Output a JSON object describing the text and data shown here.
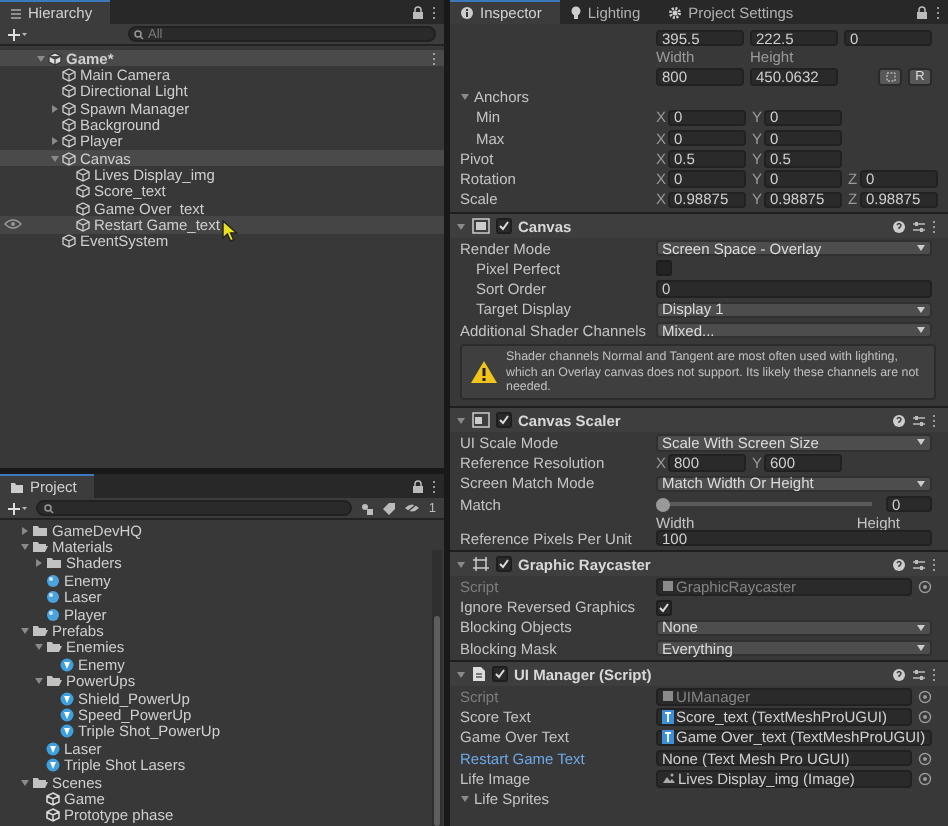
{
  "hierarchy": {
    "tab": "Hierarchy",
    "search": {
      "placeholder": "All"
    },
    "scene": {
      "name": "Game*",
      "expanded": true,
      "items": [
        {
          "name": "Main Camera",
          "selected": false,
          "hovered": false
        },
        {
          "name": "Directional Light",
          "selected": false,
          "hovered": false
        },
        {
          "name": "Spawn Manager",
          "selected": false,
          "hovered": false,
          "expanded": false
        },
        {
          "name": "Background",
          "selected": false,
          "hovered": false
        },
        {
          "name": "Player",
          "selected": false,
          "hovered": false,
          "expanded": false
        },
        {
          "name": "Canvas",
          "selected": true,
          "hovered": false,
          "expanded": true,
          "children": [
            {
              "name": "Lives Display_img",
              "selected": false,
              "hovered": false
            },
            {
              "name": "Score_text",
              "selected": false,
              "hovered": false
            },
            {
              "name": "Game Over_text",
              "selected": false,
              "hovered": false
            },
            {
              "name": "Restart Game_text",
              "selected": false,
              "hovered": true
            }
          ]
        },
        {
          "name": "EventSystem",
          "selected": false,
          "hovered": false
        }
      ]
    }
  },
  "project": {
    "tab": "Project",
    "hidden_count": "1",
    "items": [
      {
        "name": "GameDevHQ",
        "kind": "folder",
        "expanded": false
      },
      {
        "name": "Materials",
        "kind": "folder",
        "expanded": true,
        "children": [
          {
            "name": "Shaders",
            "kind": "folder",
            "expanded": false
          },
          {
            "name": "Enemy",
            "kind": "material"
          },
          {
            "name": "Laser",
            "kind": "material"
          },
          {
            "name": "Player",
            "kind": "material"
          }
        ]
      },
      {
        "name": "Prefabs",
        "kind": "folder",
        "expanded": true,
        "children": [
          {
            "name": "Enemies",
            "kind": "folder",
            "expanded": true,
            "children": [
              {
                "name": "Enemy",
                "kind": "prefab"
              }
            ]
          },
          {
            "name": "PowerUps",
            "kind": "folder",
            "expanded": true,
            "children": [
              {
                "name": "Shield_PowerUp",
                "kind": "prefab"
              },
              {
                "name": "Speed_PowerUp",
                "kind": "prefab"
              },
              {
                "name": "Triple Shot_PowerUp",
                "kind": "prefab"
              }
            ]
          },
          {
            "name": "Laser",
            "kind": "prefab"
          },
          {
            "name": "Triple Shot Lasers",
            "kind": "prefab"
          }
        ]
      },
      {
        "name": "Scenes",
        "kind": "folder",
        "expanded": true,
        "children": [
          {
            "name": "Game",
            "kind": "scene"
          },
          {
            "name": "Prototype phase",
            "kind": "scene"
          }
        ]
      }
    ]
  },
  "inspector": {
    "tabs": [
      {
        "label": "Inspector",
        "selected": true
      },
      {
        "label": "Lighting",
        "selected": false
      },
      {
        "label": "Project Settings",
        "selected": false
      }
    ],
    "sections": [
      {
        "kind": "plain",
        "rows": [
          {
            "kind": "values",
            "values": [
              "395.5",
              "222.5",
              "0"
            ]
          },
          {
            "kind": "captions",
            "values": [
              "Width",
              "Height"
            ]
          },
          {
            "kind": "values",
            "values": [
              "800",
              "450.0632"
            ],
            "button": "R"
          },
          {
            "kind": "foldout",
            "label": "Anchors",
            "expanded": true,
            "children": [
              {
                "kind": "vector",
                "label": "Min",
                "fields": [
                  {
                    "axis": "X",
                    "value": "0"
                  },
                  {
                    "axis": "Y",
                    "value": "0"
                  }
                ]
              },
              {
                "kind": "vector",
                "label": "Max",
                "fields": [
                  {
                    "axis": "X",
                    "value": "0"
                  },
                  {
                    "axis": "Y",
                    "value": "0"
                  }
                ]
              }
            ]
          },
          {
            "kind": "vector",
            "label": "Pivot",
            "fields": [
              {
                "axis": "X",
                "value": "0.5"
              },
              {
                "axis": "Y",
                "value": "0.5"
              }
            ]
          },
          {
            "kind": "vector",
            "label": "Rotation",
            "fields": [
              {
                "axis": "X",
                "value": "0"
              },
              {
                "axis": "Y",
                "value": "0"
              },
              {
                "axis": "Z",
                "value": "0"
              }
            ]
          },
          {
            "kind": "vector",
            "label": "Scale",
            "fields": [
              {
                "axis": "X",
                "value": "0.98875"
              },
              {
                "axis": "Y",
                "value": "0.98875"
              },
              {
                "axis": "Z",
                "value": "0.98875"
              }
            ]
          }
        ]
      },
      {
        "kind": "canvas",
        "name": "Canvas",
        "enabled": true,
        "expanded": true,
        "rows": [
          {
            "kind": "dropdown",
            "label": "Render Mode",
            "value": "Screen Space - Overlay",
            "children": [
              {
                "kind": "checkbox",
                "label": "Pixel Perfect",
                "checked": false
              },
              {
                "kind": "text",
                "label": "Sort Order",
                "value": "0"
              },
              {
                "kind": "dropdown",
                "label": "Target Display",
                "value": "Display 1"
              }
            ]
          },
          {
            "kind": "dropdown",
            "label": "Additional Shader Channels",
            "value": "Mixed..."
          },
          {
            "kind": "warning",
            "text": "Shader channels Normal and Tangent are most often used with lighting, which an Overlay canvas does not support. Its likely these channels are not needed."
          }
        ]
      },
      {
        "kind": "scaler",
        "name": "Canvas Scaler",
        "enabled": true,
        "expanded": true,
        "rows": [
          {
            "kind": "dropdown",
            "label": "UI Scale Mode",
            "value": "Scale With Screen Size"
          },
          {
            "kind": "vector",
            "label": "Reference Resolution",
            "fields": [
              {
                "axis": "X",
                "value": "800"
              },
              {
                "axis": "Y",
                "value": "600"
              }
            ]
          },
          {
            "kind": "dropdown",
            "label": "Screen Match Mode",
            "value": "Match Width Or Height"
          },
          {
            "kind": "slider",
            "label": "Match",
            "level": 0,
            "value": "0",
            "min_label": "Width",
            "max_label": "Height"
          },
          {
            "kind": "text",
            "label": "Reference Pixels Per Unit",
            "value": "100"
          }
        ]
      },
      {
        "kind": "raycaster",
        "name": "Graphic Raycaster",
        "enabled": true,
        "expanded": true,
        "rows": [
          {
            "kind": "script",
            "label": "Script",
            "value": "GraphicRaycaster"
          },
          {
            "kind": "checkbox",
            "label": "Ignore Reversed Graphics",
            "checked": true
          },
          {
            "kind": "dropdown",
            "label": "Blocking Objects",
            "value": "None"
          },
          {
            "kind": "dropdown",
            "label": "Blocking Mask",
            "value": "Everything"
          }
        ]
      },
      {
        "kind": "behaviour",
        "name": "UI Manager (Script)",
        "enabled": true,
        "expanded": true,
        "rows": [
          {
            "kind": "script",
            "label": "Script",
            "value": "UIManager"
          },
          {
            "kind": "textref",
            "label": "Score Text",
            "value": "Score_text (TextMeshProUGUI)",
            "highlighted": false
          },
          {
            "kind": "textref",
            "label": "Game Over Text",
            "value": "Game Over_text (TextMeshProUGUI)",
            "highlighted": false
          },
          {
            "kind": "emptyref",
            "label": "Restart Game Text",
            "value": "None (Text Mesh Pro UGUI)",
            "highlighted": true
          },
          {
            "kind": "imageref",
            "label": "Life Image",
            "value": "Lives Display_img (Image)",
            "highlighted": false
          },
          {
            "kind": "foldout",
            "label": "Life Sprites",
            "expanded": true
          }
        ]
      }
    ]
  }
}
